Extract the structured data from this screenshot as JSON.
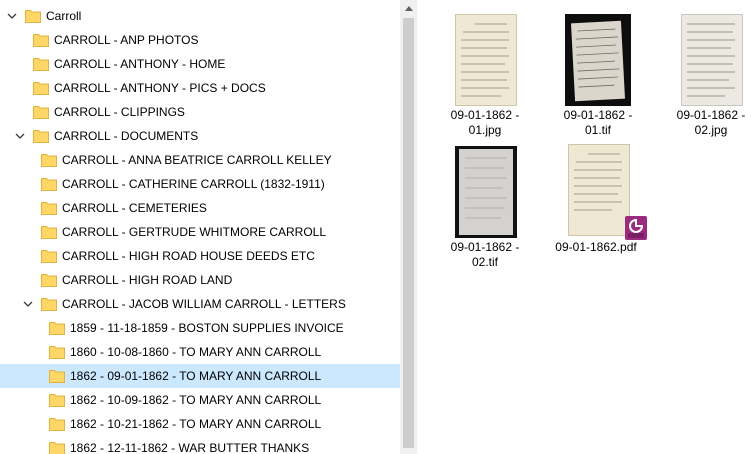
{
  "tree": {
    "items": [
      {
        "label": "Carroll",
        "level": 0,
        "expanded": true
      },
      {
        "label": "CARROLL - ANP PHOTOS",
        "level": 1
      },
      {
        "label": "CARROLL - ANTHONY - HOME",
        "level": 1
      },
      {
        "label": "CARROLL - ANTHONY - PICS + DOCS",
        "level": 1
      },
      {
        "label": "CARROLL - CLIPPINGS",
        "level": 1
      },
      {
        "label": "CARROLL - DOCUMENTS",
        "level": 1,
        "expanded": true
      },
      {
        "label": "CARROLL - ANNA BEATRICE CARROLL KELLEY",
        "level": 2
      },
      {
        "label": "CARROLL - CATHERINE CARROLL (1832-1911)",
        "level": 2
      },
      {
        "label": "CARROLL - CEMETERIES",
        "level": 2
      },
      {
        "label": "CARROLL - GERTRUDE WHITMORE CARROLL",
        "level": 2
      },
      {
        "label": "CARROLL - HIGH ROAD HOUSE DEEDS ETC",
        "level": 2
      },
      {
        "label": "CARROLL - HIGH ROAD LAND",
        "level": 2
      },
      {
        "label": "CARROLL - JACOB WILLIAM CARROLL - LETTERS",
        "level": 2,
        "expanded": true
      },
      {
        "label": "1859 - 11-18-1859 - BOSTON SUPPLIES INVOICE",
        "level": 3
      },
      {
        "label": "1860 - 10-08-1860 - TO MARY ANN CARROLL",
        "level": 3
      },
      {
        "label": "1862 - 09-01-1862 - TO MARY ANN CARROLL",
        "level": 3,
        "selected": true
      },
      {
        "label": "1862 - 10-09-1862 - TO MARY ANN CARROLL",
        "level": 3
      },
      {
        "label": "1862 - 10-21-1862 - TO MARY ANN CARROLL",
        "level": 3
      },
      {
        "label": "1862 - 12-11-1862 - WAR BUTTER THANKS",
        "level": 3
      }
    ]
  },
  "files": [
    {
      "name_line1": "09-01-1862 -",
      "name_line2": "01.jpg",
      "thumb": "light-letter"
    },
    {
      "name_line1": "09-01-1862 -",
      "name_line2": "01.tif",
      "thumb": "dark-letter"
    },
    {
      "name_line1": "09-01-1862 -",
      "name_line2": "02.jpg",
      "thumb": "light-letter"
    },
    {
      "name_line1": "09-01-1862 -",
      "name_line2": "02.tif",
      "thumb": "dark-letter"
    },
    {
      "name_line1": "09-01-1862.pdf",
      "name_line2": "",
      "thumb": "light-letter",
      "badge": "pdf-app-icon"
    }
  ],
  "colors": {
    "selection": "#cce8ff",
    "folder_fill": "#ffd766",
    "pdf_badge": "#9c2b7f"
  }
}
